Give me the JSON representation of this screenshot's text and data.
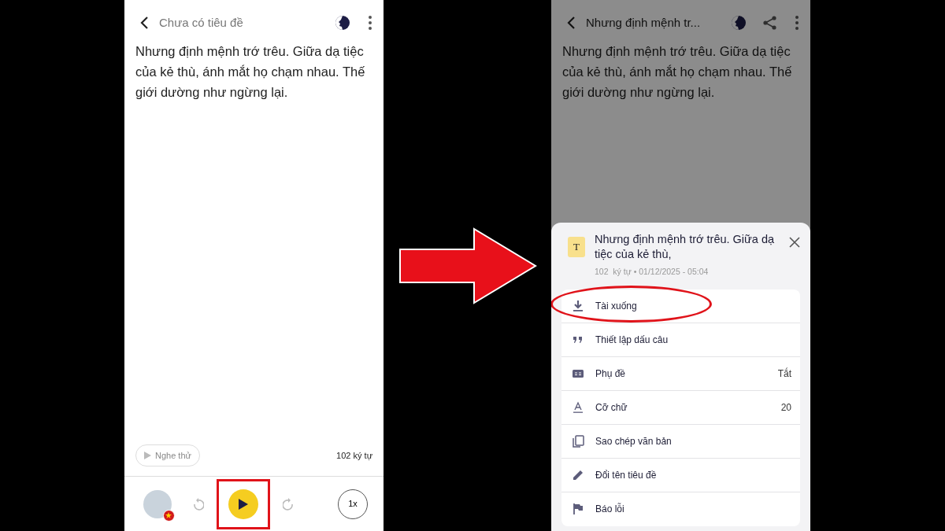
{
  "left_screen": {
    "header": {
      "title": "Chưa có tiêu đề"
    },
    "body_text": "Nhưng định mệnh trớ trêu. Giữa dạ tiệc của kẻ thù, ánh mắt họ chạm nhau. Thế giới dường như ngừng lại.",
    "preview_button": "Nghe thử",
    "char_count": "102 ký tự",
    "player": {
      "speed": "1x",
      "highlighted": true
    }
  },
  "right_screen": {
    "header": {
      "title": "Nhưng định mệnh tr..."
    },
    "body_text": "Nhưng định mệnh trớ trêu. Giữa dạ tiệc của kẻ thù, ánh mắt họ chạm nhau. Thế giới dường như ngừng lại.",
    "sheet": {
      "file_icon": "T",
      "title": "Nhưng định mệnh trớ trêu. Giữa dạ tiệc của kẻ thù,",
      "meta": "102  ký tự • 01/12/2025 - 05:04",
      "items": [
        {
          "kind": "download",
          "label": "Tài xuống",
          "highlighted": true
        },
        {
          "kind": "quote",
          "label": "Thiết lập dấu câu",
          "highlighted": false
        },
        {
          "kind": "subtitles",
          "label": "Phụ đề",
          "value": "Tắt",
          "highlighted": false
        },
        {
          "kind": "font-size",
          "label": "Cỡ chữ",
          "value": "20",
          "highlighted": false
        },
        {
          "kind": "copy",
          "label": "Sao chép văn bản",
          "highlighted": false
        },
        {
          "kind": "rename",
          "label": "Đổi tên tiêu đề",
          "highlighted": false
        },
        {
          "kind": "report",
          "label": "Báo lỗi",
          "highlighted": false
        }
      ]
    }
  }
}
